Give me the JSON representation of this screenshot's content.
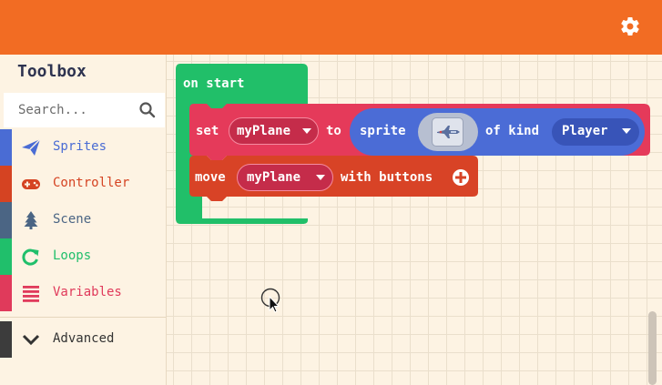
{
  "toolbox": {
    "title": "Toolbox",
    "search_placeholder": "Search...",
    "categories": [
      {
        "label": "Sprites",
        "color": "#4a6cd4",
        "icon": "paper-plane-icon"
      },
      {
        "label": "Controller",
        "color": "#d54322",
        "icon": "gamepad-icon"
      },
      {
        "label": "Scene",
        "color": "#4b6584",
        "icon": "tree-icon"
      },
      {
        "label": "Loops",
        "color": "#20bf6b",
        "icon": "loop-arrow-icon"
      },
      {
        "label": "Variables",
        "color": "#e03a5b",
        "icon": "list-icon"
      }
    ],
    "advanced": {
      "label": "Advanced",
      "icon": "chevron-down-icon"
    }
  },
  "blocks": {
    "on_start": {
      "label": "on start",
      "color": "#21bf69"
    },
    "set": {
      "set_label": "set",
      "variable": "myPlane",
      "to_label": "to",
      "color": "#e53a5a",
      "sprite": {
        "sprite_label": "sprite",
        "of_kind_label": "of kind",
        "kind": "Player",
        "color": "#4b6cd6"
      }
    },
    "move": {
      "move_label": "move",
      "variable": "myPlane",
      "with_buttons_label": "with buttons",
      "color": "#d84326"
    }
  },
  "colors": {
    "topbar": "#f26c23",
    "workspace": "#fdf3e3"
  }
}
